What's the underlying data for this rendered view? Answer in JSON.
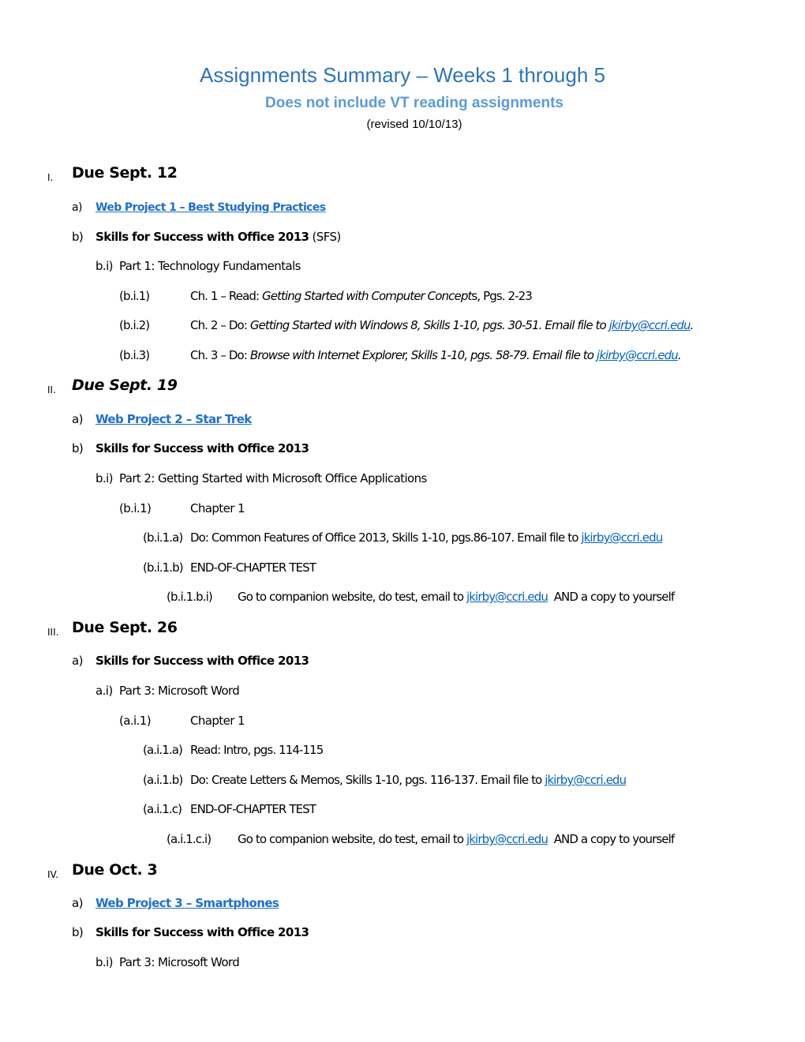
{
  "header": {
    "title": "Assignments Summary – Weeks 1 through 5",
    "subtitle": "Does not include VT reading assignments",
    "revised": "(revised 10/10/13)"
  },
  "colors": {
    "title": "#2e74b5",
    "subtitle": "#5b9bd5",
    "link": "#0563c1"
  },
  "email": "jkirby@ccri.edu",
  "sections": [
    {
      "numeral": "I.",
      "heading": "Due Sept. 12",
      "items": [
        {
          "label": "a)",
          "link": "Web Project 1 – Best Studying Practices"
        },
        {
          "label": "b)",
          "bold": "Skills for Success with Office 2013",
          "rest": " (SFS)"
        },
        {
          "label": "b.i)",
          "text": "Part 1: Technology Fundamentals"
        },
        {
          "label": "(b.i.1)",
          "prefix": "Ch. 1 – Read: ",
          "italic": "Getting Started with Computer Concept",
          "suffix": "s, Pgs. 2-23"
        },
        {
          "label": "(b.i.2)",
          "prefix": "Ch. 2 – Do: ",
          "italic": "Getting Started with Windows 8, Skills 1-10, pgs. 30-51. Email file to ",
          "email": "jkirby@ccri.edu",
          "suffix": "."
        },
        {
          "label": "(b.i.3)",
          "prefix": "Ch. 3 – Do: ",
          "italic": "Browse with Internet Explorer, Skills 1-10, pgs. 58-79. Email file to ",
          "email": "jkirby@ccri.edu",
          "suffix": "."
        }
      ]
    },
    {
      "numeral": "II.",
      "heading": "Due Sept. 19",
      "items": [
        {
          "label": "a)",
          "link": "Web Project 2 – Star Trek"
        },
        {
          "label": "b)",
          "bold": "Skills for Success with Office 2013"
        },
        {
          "label": "b.i)",
          "text": "Part 2: Getting Started with Microsoft Office Applications"
        },
        {
          "label": "(b.i.1)",
          "text": "Chapter 1"
        },
        {
          "label": "(b.i.1.a)",
          "text": "Do: Common Features of Office 2013, Skills 1-10, pgs.86-107. Email file to ",
          "email": "jkirby@ccri.edu"
        },
        {
          "label": "(b.i.1.b)",
          "text": "END-OF-CHAPTER TEST"
        },
        {
          "label": "(b.i.1.b.i)",
          "text": "Go to companion website, do test, email to ",
          "email": "jkirby@ccri.edu",
          "suffix": "  AND a copy to yourself"
        }
      ]
    },
    {
      "numeral": "III.",
      "heading": "Due Sept. 26",
      "items": [
        {
          "label": "a)",
          "bold": "Skills for Success with Office 2013"
        },
        {
          "label": "a.i)",
          "text": "Part 3: Microsoft Word"
        },
        {
          "label": "(a.i.1)",
          "text": "Chapter 1"
        },
        {
          "label": "(a.i.1.a)",
          "text": "Read: Intro, pgs. 114-115"
        },
        {
          "label": "(a.i.1.b)",
          "text": "Do: Create Letters & Memos, Skills 1-10, pgs. 116-137. Email file to ",
          "email": "jkirby@ccri.edu"
        },
        {
          "label": "(a.i.1.c)",
          "text": "END-OF-CHAPTER TEST"
        },
        {
          "label": "(a.i.1.c.i)",
          "text": "Go to companion website, do test, email to ",
          "email": "jkirby@ccri.edu",
          "suffix": "  AND a copy to yourself"
        }
      ]
    },
    {
      "numeral": "IV.",
      "heading": "Due Oct. 3",
      "items": [
        {
          "label": "a)",
          "link": "Web Project 3 – Smartphones"
        },
        {
          "label": "b)",
          "bold": "Skills for Success with Office 2013"
        },
        {
          "label": "b.i)",
          "text": "Part 3: Microsoft Word"
        }
      ]
    }
  ]
}
